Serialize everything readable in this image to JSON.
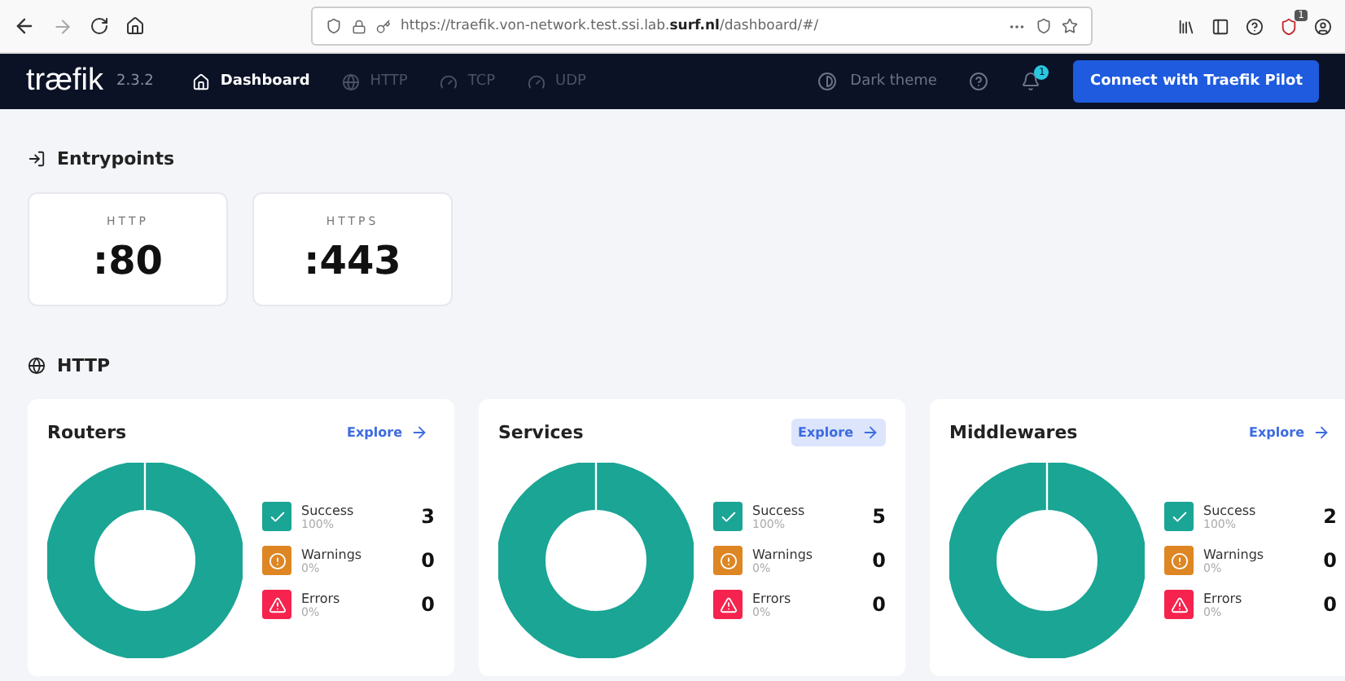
{
  "browser": {
    "url": "https://traefik.von-network.test.ssi.lab.**surf.nl**/dashboard/#/",
    "extension_badge": "1"
  },
  "nav": {
    "logo": "træfik",
    "version": "2.3.2",
    "links": [
      {
        "label": "Dashboard",
        "kind": "home",
        "selected": true
      },
      {
        "label": "HTTP",
        "kind": "globe",
        "selected": false
      },
      {
        "label": "TCP",
        "kind": "gauge",
        "selected": false
      },
      {
        "label": "UDP",
        "kind": "gauge",
        "selected": false
      }
    ],
    "theme_toggle": "Dark theme",
    "notification_badge": "1",
    "pilot_button": "Connect with Traefik Pilot"
  },
  "entrypoints": {
    "title": "Entrypoints",
    "items": [
      {
        "name": "HTTP",
        "port": ":80"
      },
      {
        "name": "HTTPS",
        "port": ":443"
      }
    ]
  },
  "http": {
    "title": "HTTP",
    "cards": [
      {
        "title": "Routers",
        "explore": "Explore",
        "explore_hovered": false,
        "stats": [
          {
            "kind": "success",
            "label": "Success",
            "percent": "100%",
            "count": "3"
          },
          {
            "kind": "warning",
            "label": "Warnings",
            "percent": "0%",
            "count": "0"
          },
          {
            "kind": "error",
            "label": "Errors",
            "percent": "0%",
            "count": "0"
          }
        ]
      },
      {
        "title": "Services",
        "explore": "Explore",
        "explore_hovered": true,
        "stats": [
          {
            "kind": "success",
            "label": "Success",
            "percent": "100%",
            "count": "5"
          },
          {
            "kind": "warning",
            "label": "Warnings",
            "percent": "0%",
            "count": "0"
          },
          {
            "kind": "error",
            "label": "Errors",
            "percent": "0%",
            "count": "0"
          }
        ]
      },
      {
        "title": "Middlewares",
        "explore": "Explore",
        "explore_hovered": false,
        "stats": [
          {
            "kind": "success",
            "label": "Success",
            "percent": "100%",
            "count": "2"
          },
          {
            "kind": "warning",
            "label": "Warnings",
            "percent": "0%",
            "count": "0"
          },
          {
            "kind": "error",
            "label": "Errors",
            "percent": "0%",
            "count": "0"
          }
        ]
      }
    ]
  }
}
